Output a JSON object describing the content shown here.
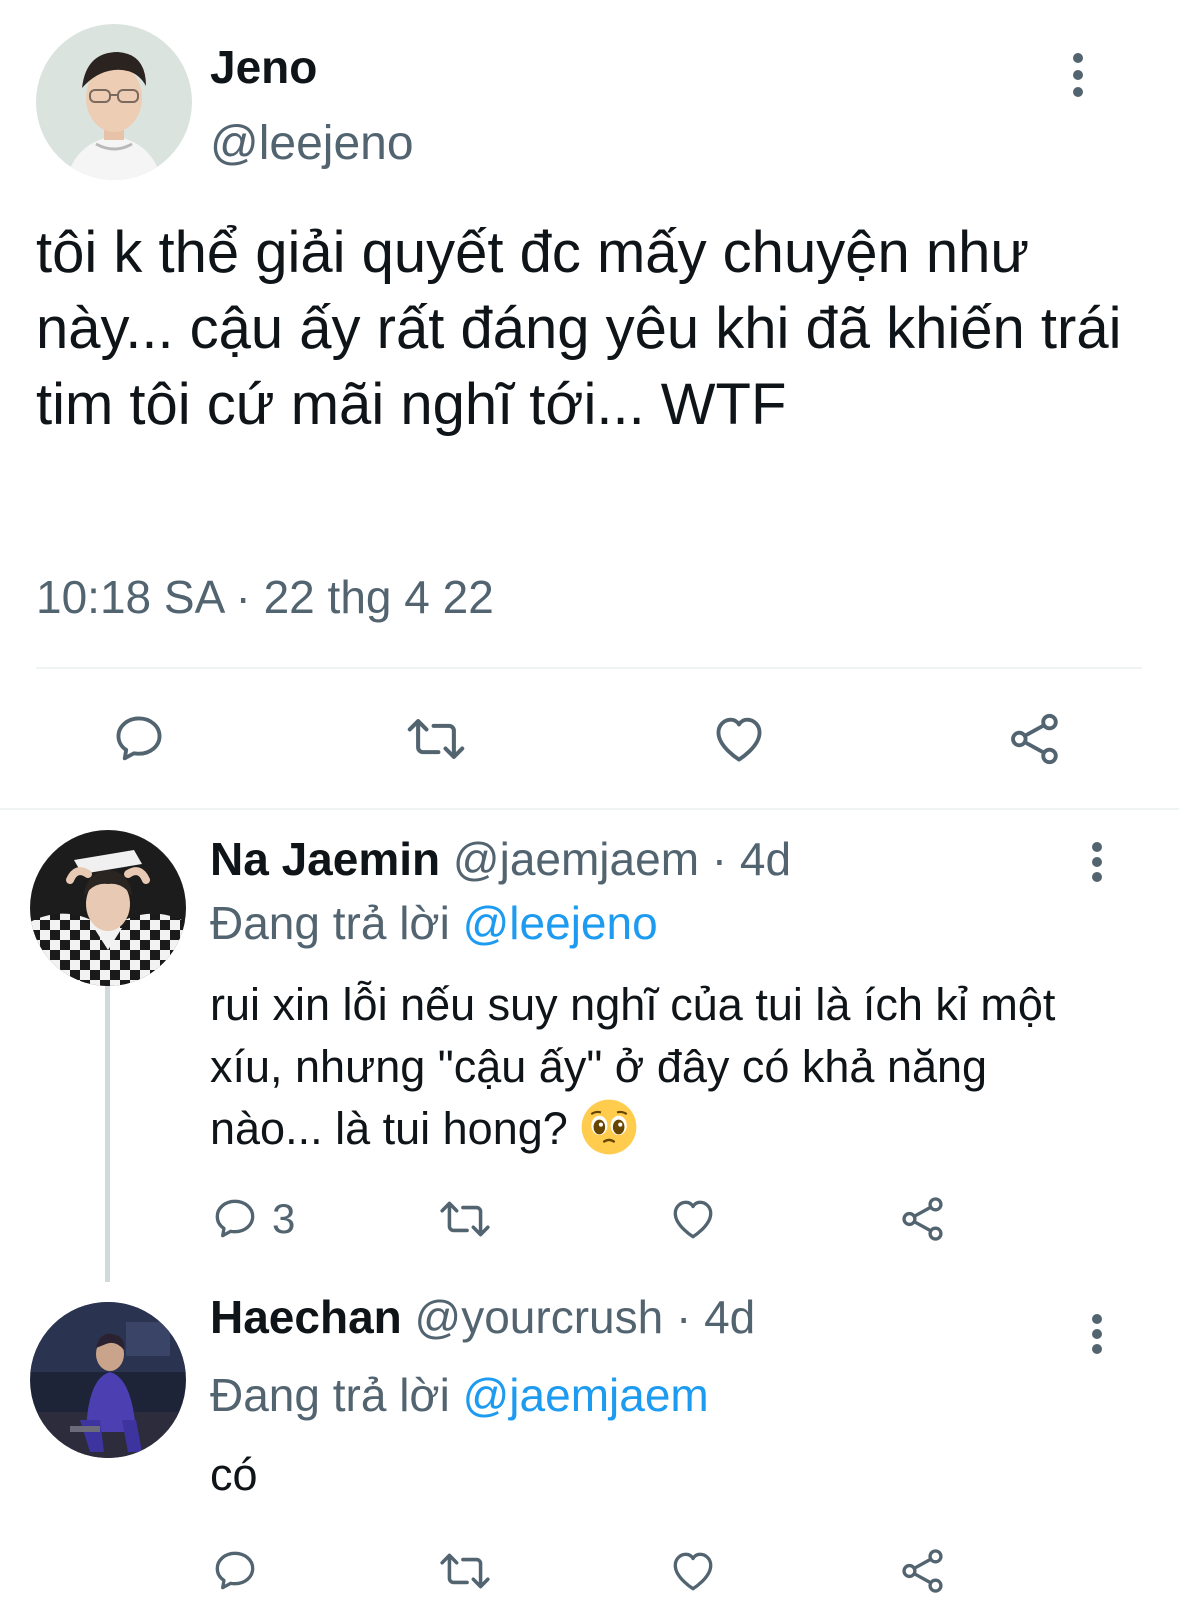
{
  "main_tweet": {
    "author": {
      "name": "Jeno",
      "handle": "@leejeno"
    },
    "text": "tôi k thể giải quyết đc mấy chuyện như này... cậu ấy rất đáng yêu khi đã khiến trái tim tôi cứ mãi nghĩ tới... WTF",
    "timestamp": "10:18 SA · 22 thg 4 22"
  },
  "replies": [
    {
      "name": "Na Jaemin",
      "handle": "@jaemjaem",
      "age": "· 4d",
      "replying_prefix": "Đang trả lời",
      "replying_to": "@leejeno",
      "text": "rui xin lỗi nếu suy nghĩ của tui là ích kỉ một xíu, nhưng \"cậu ấy\" ở đây có khả năng nào... là tui hong?",
      "emoji": "pleading-face",
      "reply_count": "3"
    },
    {
      "name": "Haechan",
      "handle": "@yourcrush",
      "age": "· 4d",
      "replying_prefix": "Đang trả lời",
      "replying_to": "@jaemjaem",
      "text": "có",
      "reply_count": ""
    }
  ],
  "icons": {
    "reply": "speech-bubble-icon",
    "retweet": "retweet-icon",
    "like": "heart-icon",
    "share": "share-icon",
    "more": "more-vertical-icon"
  },
  "colors": {
    "text": "#0f1419",
    "secondary": "#536471",
    "link": "#1d9bf0",
    "divider": "#eff3f4"
  }
}
